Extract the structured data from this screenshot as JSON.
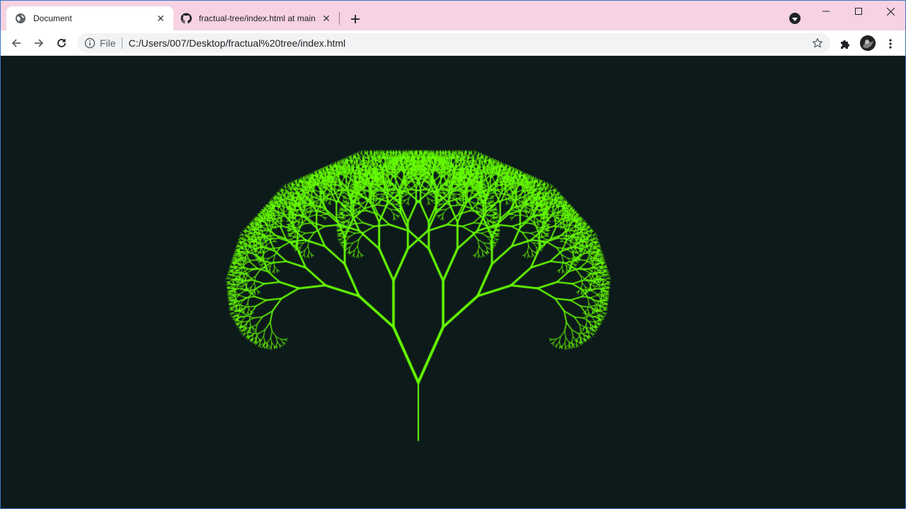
{
  "theme": {
    "strip": "#f6d2e2",
    "content_bg": "#0d1a1a",
    "tree_color": "#66ff00"
  },
  "tabs": [
    {
      "title": "Document",
      "favicon": "globe-icon",
      "active": true
    },
    {
      "title": "fractual-tree/index.html at main",
      "favicon": "github-icon",
      "active": false
    }
  ],
  "omnibox": {
    "scheme": "File",
    "url": "C:/Users/007/Desktop/fractual%20tree/index.html"
  },
  "icons": {
    "back": "arrow-left-icon",
    "forward": "arrow-right-icon",
    "reload": "reload-icon",
    "info": "info-icon",
    "bookmark": "star-icon",
    "extensions": "puzzle-icon",
    "menu": "kebab-menu-icon",
    "new_tab": "plus-icon",
    "tab_search": "chevron-down-icon"
  }
}
